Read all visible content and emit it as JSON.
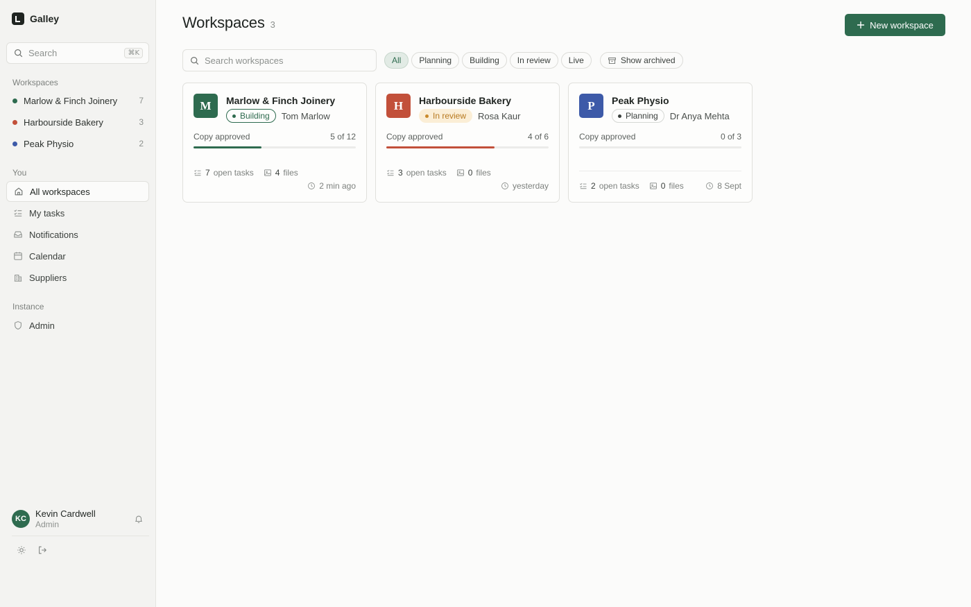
{
  "app": {
    "name": "Galley"
  },
  "sidebar": {
    "search": {
      "placeholder": "Search",
      "shortcut": "⌘K"
    },
    "workspaces_label": "Workspaces",
    "workspaces": [
      {
        "name": "Marlow & Finch Joinery",
        "count": "7",
        "color": "#2e6b4f"
      },
      {
        "name": "Harbourside Bakery",
        "count": "3",
        "color": "#c2503a"
      },
      {
        "name": "Peak Physio",
        "count": "2",
        "color": "#3d5aa8"
      }
    ],
    "you_label": "You",
    "nav": [
      {
        "label": "All workspaces",
        "icon": "home-icon",
        "active": true
      },
      {
        "label": "My tasks",
        "icon": "checklist-icon"
      },
      {
        "label": "Notifications",
        "icon": "inbox-icon"
      },
      {
        "label": "Calendar",
        "icon": "calendar-icon"
      },
      {
        "label": "Suppliers",
        "icon": "building-icon"
      }
    ],
    "instance_label": "Instance",
    "admin": {
      "label": "Admin",
      "icon": "shield-icon"
    },
    "user": {
      "initials": "KC",
      "name": "Kevin Cardwell",
      "role": "Admin"
    }
  },
  "header": {
    "title": "Workspaces",
    "count": "3",
    "new_button": "New workspace"
  },
  "filters": {
    "search_placeholder": "Search workspaces",
    "chips": [
      "All",
      "Planning",
      "Building",
      "In review",
      "Live"
    ],
    "active": "All",
    "archived_label": "Show archived"
  },
  "cards": [
    {
      "initial": "M",
      "color": "#2e6b4f",
      "name": "Marlow & Finch Joinery",
      "status": "Building",
      "owner": "Tom Marlow",
      "progress_label": "Copy approved",
      "progress_text": "5 of 12",
      "progress": 0.4167,
      "tasks": "7",
      "tasks_label": "open tasks",
      "files": "4",
      "files_label": "files",
      "updated": "2 min ago"
    },
    {
      "initial": "H",
      "color": "#c2503a",
      "name": "Harbourside Bakery",
      "status": "In review",
      "owner": "Rosa Kaur",
      "progress_label": "Copy approved",
      "progress_text": "4 of 6",
      "progress": 0.6667,
      "tasks": "3",
      "tasks_label": "open tasks",
      "files": "0",
      "files_label": "files",
      "updated": "yesterday"
    },
    {
      "initial": "P",
      "color": "#3d5aa8",
      "name": "Peak Physio",
      "status": "Planning",
      "owner": "Dr Anya Mehta",
      "progress_label": "Copy approved",
      "progress_text": "0 of 3",
      "progress": 0,
      "tasks": "2",
      "tasks_label": "open tasks",
      "files": "0",
      "files_label": "files",
      "updated": "8 Sept"
    }
  ]
}
